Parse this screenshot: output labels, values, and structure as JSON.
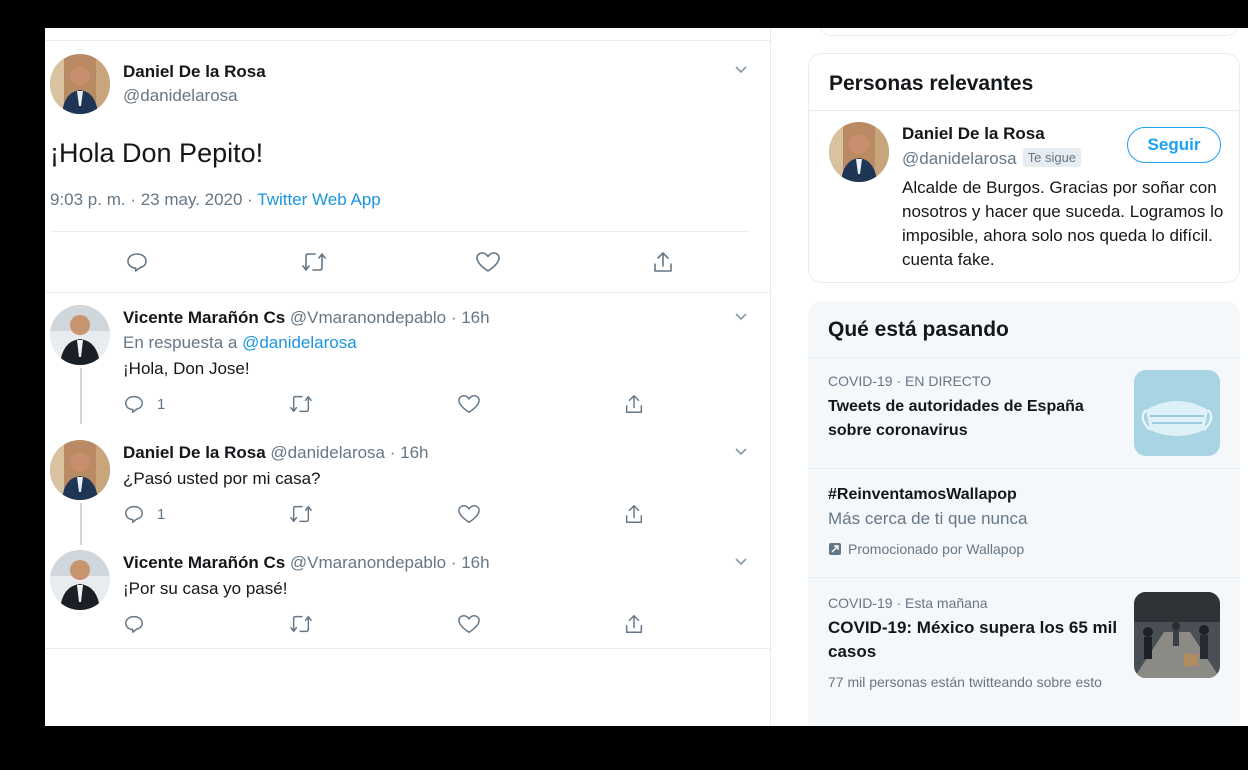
{
  "colors": {
    "accent": "#1da1f2",
    "link": "#1b95e0",
    "text": "#14171a",
    "muted": "#657786",
    "border": "#e6ecf0",
    "panel": "#f5f8fa"
  },
  "main_tweet": {
    "name": "Daniel De la Rosa",
    "handle": "@danidelarosa",
    "text": "¡Hola Don Pepito!",
    "time_date": "9:03 p. m. · 23 may. 2020 · ",
    "source": "Twitter Web App",
    "actions": [
      "reply-icon",
      "retweet-icon",
      "like-icon",
      "share-icon"
    ]
  },
  "replies": [
    {
      "name": "Vicente Marañón Cs",
      "handle": "@Vmaranondepablo",
      "time": " · 16h",
      "reply_prefix": "En respuesta a ",
      "reply_to": "@danidelarosa",
      "text": "¡Hola, Don Jose!",
      "reply_count": "1"
    },
    {
      "name": "Daniel De la Rosa",
      "handle": "@danidelarosa",
      "time": " · 16h",
      "text": "¿Pasó usted por mi casa?",
      "reply_count": "1"
    },
    {
      "name": "Vicente Marañón Cs",
      "handle": "@Vmaranondepablo",
      "time": " · 16h",
      "text": "¡Por su casa yo pasé!",
      "reply_count": ""
    }
  ],
  "relevant_people": {
    "title": "Personas relevantes",
    "name": "Daniel De la Rosa",
    "handle": "@danidelarosa",
    "follows_you": "Te sigue",
    "follow_label": "Seguir",
    "bio": "Alcalde de Burgos. Gracias por soñar con nosotros y hacer que suceda. Logramos lo imposible, ahora solo nos queda lo difícil. cuenta fake."
  },
  "trends": {
    "title": "Qué está pasando",
    "items": [
      {
        "context": "COVID-19 · EN DIRECTO",
        "title": "Tweets de autoridades de España sobre coronavirus"
      },
      {
        "title": "#ReinventamosWallapop",
        "description": "Más cerca de ti que nunca",
        "promoted": "Promocionado por Wallapop"
      },
      {
        "context": "COVID-19 · Esta mañana",
        "title": "COVID-19: México supera los 65 mil casos",
        "meta": "77 mil personas están twitteando sobre esto"
      }
    ]
  }
}
